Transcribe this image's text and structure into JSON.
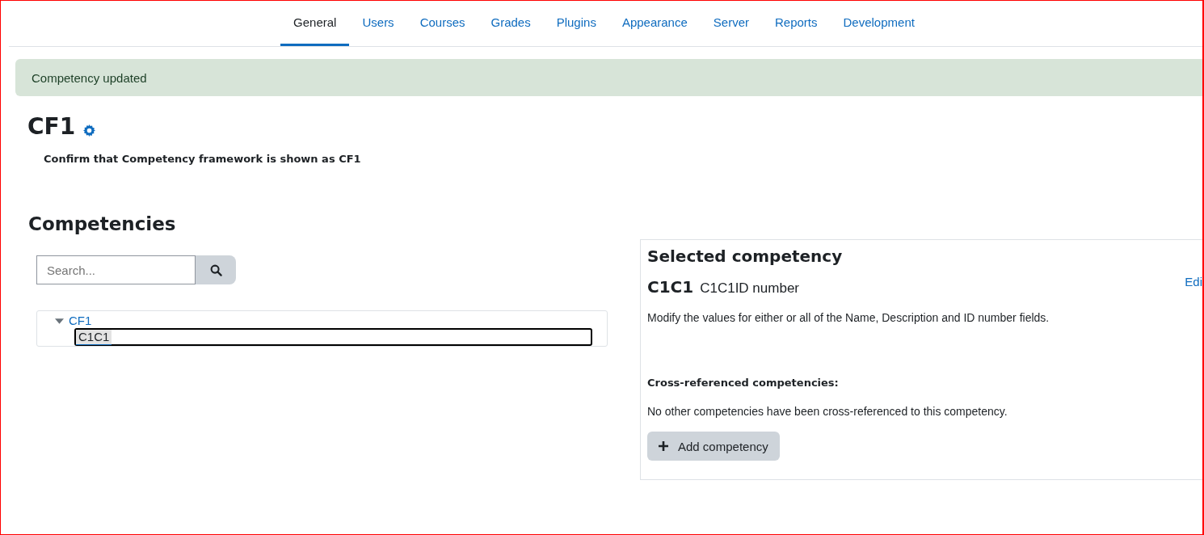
{
  "nav": {
    "tabs": [
      {
        "label": "General",
        "selected": true
      },
      {
        "label": "Users",
        "selected": false
      },
      {
        "label": "Courses",
        "selected": false
      },
      {
        "label": "Grades",
        "selected": false
      },
      {
        "label": "Plugins",
        "selected": false
      },
      {
        "label": "Appearance",
        "selected": false
      },
      {
        "label": "Server",
        "selected": false
      },
      {
        "label": "Reports",
        "selected": false
      },
      {
        "label": "Development",
        "selected": false
      }
    ]
  },
  "alert": "Competency updated",
  "page_title": "CF1",
  "confirm_text": "Confirm that Competency framework is shown as CF1",
  "section_title": "Competencies",
  "search": {
    "placeholder": "Search..."
  },
  "tree": [
    {
      "label": "CF1",
      "expanded": true,
      "selected": false,
      "children": [
        {
          "label": "C1C1",
          "selected": true
        }
      ]
    }
  ],
  "selected_panel": {
    "title": "Selected competency",
    "name": "C1C1",
    "idnumber": "C1C1ID number",
    "edit_link": "Edi",
    "description": "Modify the values for either or all of the Name, Description and ID number fields.",
    "cross_ref_title": "Cross-referenced competencies:",
    "cross_ref_text": "No other competencies have been cross-referenced to this competency.",
    "add_button": "Add competency"
  }
}
